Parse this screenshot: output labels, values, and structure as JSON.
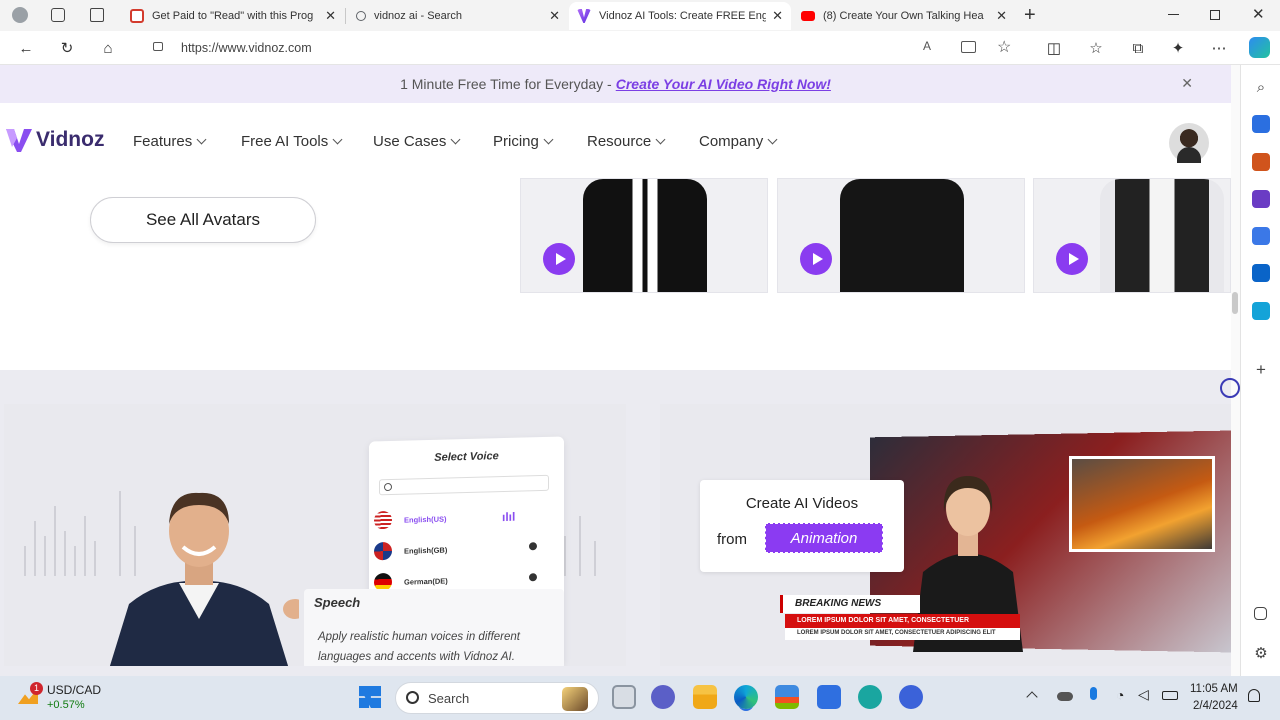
{
  "browser": {
    "tabs": [
      {
        "title": "Get Paid to \"Read\" with this Prog",
        "icon": "gmail-icon",
        "color": "#d33b2d"
      },
      {
        "title": "vidnoz ai - Search",
        "icon": "search-icon",
        "color": "#5f6368"
      },
      {
        "title": "Vidnoz AI Tools: Create FREE Eng",
        "icon": "vidnoz-icon",
        "color": "#7b3fe4",
        "active": true
      },
      {
        "title": "(8) Create Your Own Talking Hea",
        "icon": "youtube-icon",
        "color": "#ff0000"
      }
    ],
    "url": "https://www.vidnoz.com"
  },
  "promo": {
    "text": "1 Minute Free Time for Everyday -",
    "link": "Create Your AI Video Right Now!"
  },
  "nav": {
    "brand": "Vidnoz",
    "items": [
      "Features",
      "Free AI Tools",
      "Use Cases",
      "Pricing",
      "Resource",
      "Company"
    ]
  },
  "avatars": {
    "see_all_label": "See All Avatars"
  },
  "voice_card": {
    "panel_title": "Select Voice",
    "voices": [
      "English(US)",
      "English(GB)",
      "German(DE)"
    ],
    "speech_title": "Speech",
    "speech_desc": "Apply realistic human voices in different languages and accents with Vidnoz AI."
  },
  "animation_card": {
    "line1": "Create AI Videos",
    "from": "from",
    "highlight": "Animation",
    "breaking": "BREAKING NEWS",
    "ticker1": "LOREM IPSUM DOLOR SIT AMET, CONSECTETUER",
    "ticker2": "LOREM IPSUM DOLOR SIT AMET, CONSECTETUER ADIPISCING ELIT"
  },
  "taskbar": {
    "ticker_name": "USD/CAD",
    "ticker_change": "+0.57%",
    "search_placeholder": "Search",
    "time": "11:05 AM",
    "date": "2/4/2024",
    "notification_count": "1"
  },
  "colors": {
    "accent": "#7b3fe4",
    "play": "#8a3cf0",
    "news_red": "#d50f0f"
  }
}
